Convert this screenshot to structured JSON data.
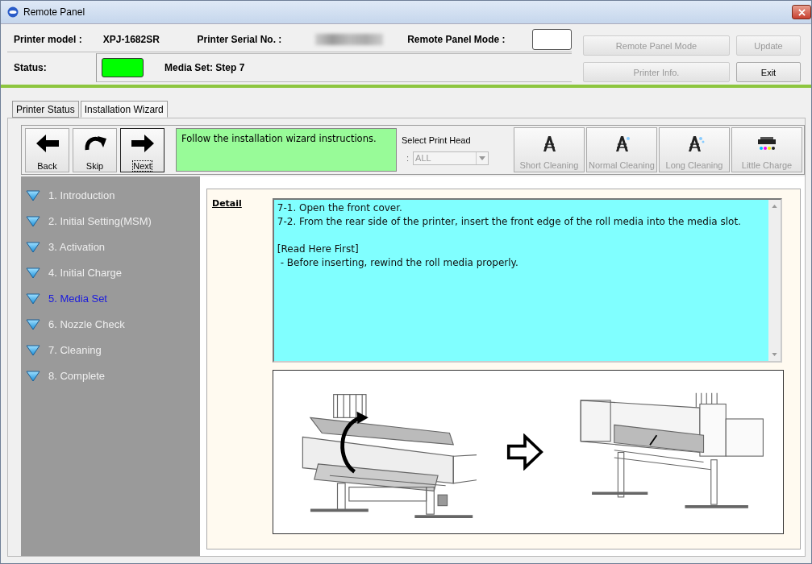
{
  "window": {
    "title": "Remote Panel"
  },
  "header": {
    "model_label": "Printer model :",
    "model": "XPJ-1682SR",
    "serial_label": "Printer Serial No. :",
    "mode_label": "Remote Panel Mode :",
    "status_label": "Status:",
    "lamp_on": true,
    "status_text": "Media Set: Step 7",
    "buttons": [
      {
        "label": "Remote Panel Mode",
        "disabled": true
      },
      {
        "label": "Update",
        "disabled": true
      },
      {
        "label": "Printer Info.",
        "disabled": true
      },
      {
        "label": "Exit",
        "disabled": false
      }
    ]
  },
  "tabs": [
    {
      "label": "Printer Status",
      "selected": false
    },
    {
      "label": "Installation Wizard",
      "selected": true
    }
  ],
  "nav_buttons": [
    {
      "label": "Back",
      "kind": "back",
      "focused": false
    },
    {
      "label": "Skip",
      "kind": "skip",
      "focused": false
    },
    {
      "label": "Next",
      "kind": "next",
      "focused": true
    }
  ],
  "message": "Follow the installation wizard instructions.",
  "print_head": {
    "label": "Select Print Head",
    "prefix": ":",
    "value": "ALL",
    "disabled": true
  },
  "cleaning_buttons": [
    {
      "label": "Short Cleaning",
      "kind": "short",
      "disabled": true
    },
    {
      "label": "Normal Cleaning",
      "kind": "normal",
      "disabled": true
    },
    {
      "label": "Long Cleaning",
      "kind": "long",
      "disabled": true
    },
    {
      "label": "Little Charge",
      "kind": "charge",
      "disabled": true
    }
  ],
  "steps": [
    {
      "label": "1. Introduction",
      "selected": false
    },
    {
      "label": "2. Initial Setting(MSM)",
      "selected": false
    },
    {
      "label": "3. Activation",
      "selected": false
    },
    {
      "label": "4. Initial Charge",
      "selected": false
    },
    {
      "label": "5. Media Set",
      "selected": true
    },
    {
      "label": "6. Nozzle Check",
      "selected": false
    },
    {
      "label": "7. Cleaning",
      "selected": false
    },
    {
      "label": "8. Complete",
      "selected": false
    }
  ],
  "detail": {
    "label": "Detail",
    "text": "7-1. Open the front cover.\n7-2. From the rear side of the printer, insert the front edge of the roll media into the media slot.\n\n[Read Here First]\n - Before inserting, rewind the roll media properly."
  }
}
